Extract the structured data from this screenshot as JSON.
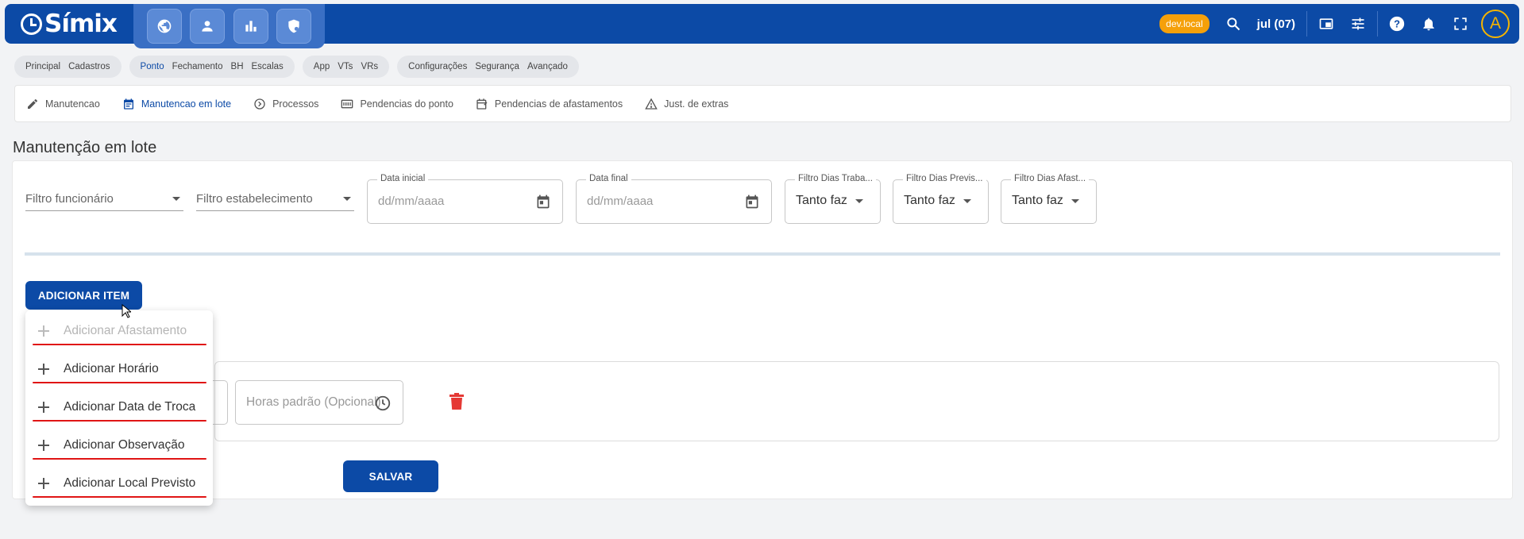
{
  "app": {
    "logo": "Símix",
    "env_badge": "dev.local",
    "month": "jul (07)",
    "avatar_letter": "A"
  },
  "topbar_apps": [
    "globe-icon",
    "person-icon",
    "bar-chart-icon",
    "shield-icon"
  ],
  "topbar_icons": [
    "search-icon",
    "picture-in-picture-icon",
    "tune-icon",
    "help-icon",
    "bell-icon",
    "fullscreen-icon"
  ],
  "modules": [
    {
      "items": [
        "Principal",
        "Cadastros"
      ]
    },
    {
      "items": [
        "Ponto",
        "Fechamento",
        "BH",
        "Escalas"
      ],
      "active": 0
    },
    {
      "items": [
        "App",
        "VTs",
        "VRs"
      ]
    },
    {
      "items": [
        "Configurações",
        "Segurança",
        "Avançado"
      ]
    }
  ],
  "subnav": [
    {
      "label": "Manutencao",
      "icon": "pencil-icon"
    },
    {
      "label": "Manutencao em lote",
      "icon": "calendar-icon",
      "active": true
    },
    {
      "label": "Processos",
      "icon": "arrow-circle-icon"
    },
    {
      "label": "Pendencias do ponto",
      "icon": "card-icon"
    },
    {
      "label": "Pendencias de afastamentos",
      "icon": "calendar-edit-icon"
    },
    {
      "label": "Just. de extras",
      "icon": "warning-icon"
    }
  ],
  "page": {
    "title": "Manutenção em lote"
  },
  "filters": {
    "employee": "Filtro funcionário",
    "establishment": "Filtro estabelecimento",
    "date_start": {
      "label": "Data inicial",
      "placeholder": "dd/mm/aaaa"
    },
    "date_end": {
      "label": "Data final",
      "placeholder": "dd/mm/aaaa"
    },
    "worked_days": {
      "label": "Filtro Dias Traba...",
      "value": "Tanto faz"
    },
    "planned_days": {
      "label": "Filtro Dias Previs...",
      "value": "Tanto faz"
    },
    "leave_days": {
      "label": "Filtro Dias Afast...",
      "value": "Tanto faz"
    }
  },
  "actions": {
    "add_item": "ADICIONAR ITEM",
    "save": "SALVAR"
  },
  "row": {
    "hours_placeholder": "Horas padrão (Opcional)"
  },
  "menu": [
    {
      "label": "Adicionar Afastamento",
      "disabled": true
    },
    {
      "label": "Adicionar Horário"
    },
    {
      "label": "Adicionar Data de Troca"
    },
    {
      "label": "Adicionar Observação"
    },
    {
      "label": "Adicionar Local Previsto"
    }
  ],
  "colors": {
    "primary": "#0c4aa6",
    "badge": "#f5a00a",
    "delete": "#e53935",
    "annotation": "#e01515"
  }
}
